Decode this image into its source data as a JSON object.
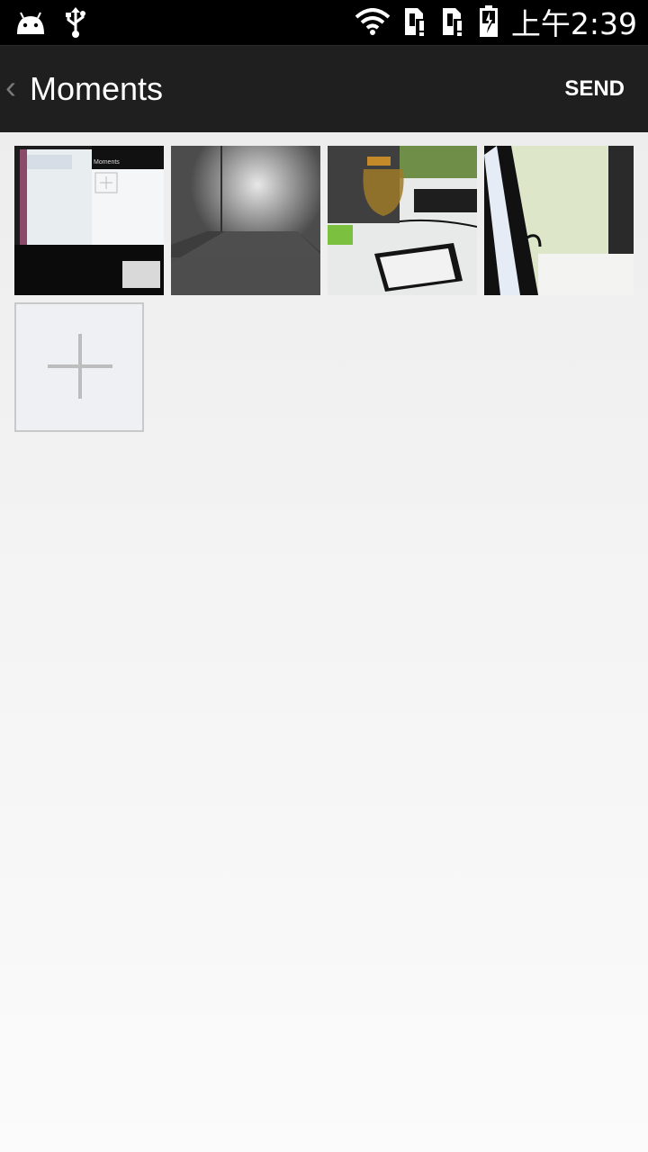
{
  "status_bar": {
    "time": "上午2:39",
    "icons": [
      "android-icon",
      "usb-icon",
      "wifi-icon",
      "sim1-alert-icon",
      "sim2-alert-icon",
      "battery-charging-icon"
    ]
  },
  "action_bar": {
    "back_glyph": "‹",
    "title": "Moments",
    "send_label": "SEND"
  },
  "photos": [
    {
      "name": "photo-thumbnail-1",
      "subject": "monitor screen"
    },
    {
      "name": "photo-thumbnail-2",
      "subject": "glass door"
    },
    {
      "name": "photo-thumbnail-3",
      "subject": "desk with jar and phone"
    },
    {
      "name": "photo-thumbnail-4",
      "subject": "laptop edge"
    }
  ],
  "add_button": {
    "icon": "plus-icon"
  },
  "colors": {
    "status_bar_bg": "#000000",
    "action_bar_bg": "#1f1f1f",
    "text_primary": "#ffffff",
    "add_border": "#c9c9c9"
  }
}
